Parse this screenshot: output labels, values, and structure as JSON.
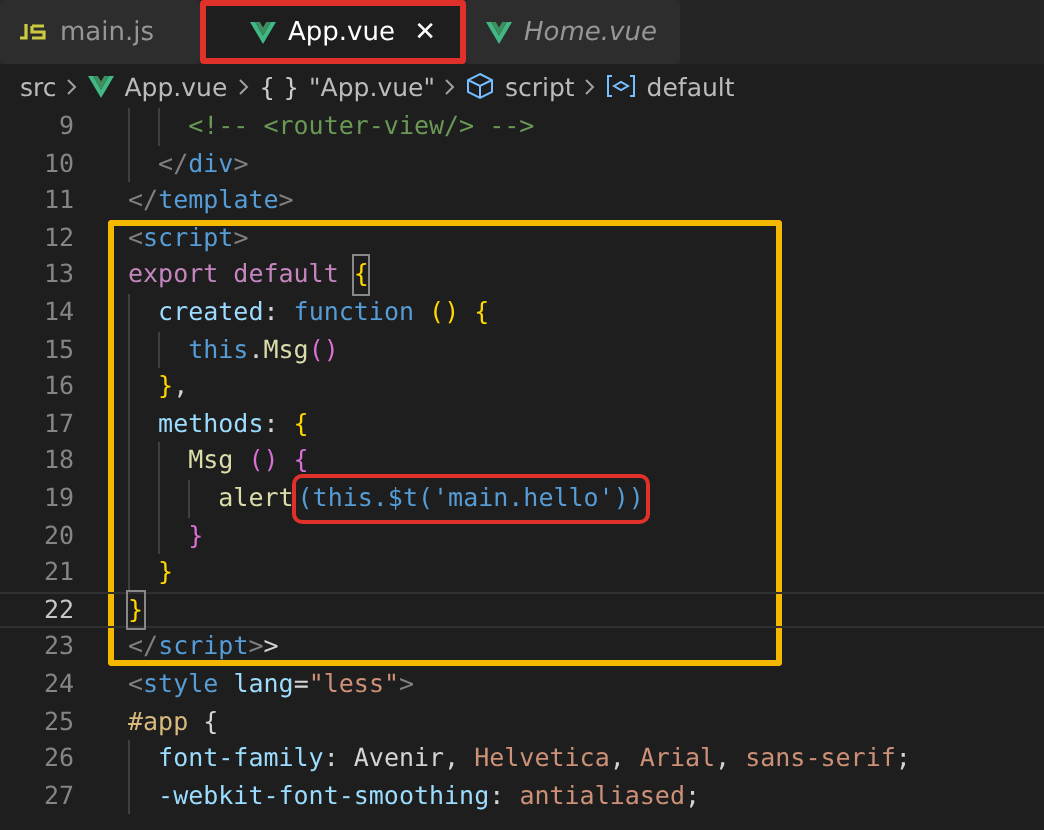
{
  "tabs": [
    {
      "label": "main.js",
      "kind": "script",
      "selected": false,
      "preview": false,
      "boxed": false
    },
    {
      "label": "App.vue",
      "kind": "component",
      "selected": true,
      "preview": false,
      "boxed": true,
      "close": "✕"
    },
    {
      "label": "Home.vue",
      "kind": "component",
      "selected": false,
      "preview": true,
      "boxed": false
    }
  ],
  "breadcrumb": [
    {
      "label": "src",
      "kind": "folder"
    },
    {
      "label": "App.vue",
      "kind": "file"
    },
    {
      "label": "\"App.vue\"",
      "kind": "object",
      "glyph": "{ }"
    },
    {
      "label": "script",
      "kind": "element"
    },
    {
      "label": "default",
      "kind": "symbol"
    }
  ],
  "lines": [
    {
      "number": "9",
      "boxed": false,
      "current": false,
      "tokens": [
        {
          "text": "    <!-- <router-view/> -->",
          "kind": "comment"
        }
      ]
    },
    {
      "number": "10",
      "boxed": false,
      "current": false,
      "tokens": [
        {
          "text": "  </",
          "kind": "tagpunct"
        },
        {
          "text": "div",
          "kind": "tag"
        },
        {
          "text": ">",
          "kind": "tagpunct"
        }
      ]
    },
    {
      "number": "11",
      "boxed": false,
      "current": false,
      "tokens": [
        {
          "text": "</",
          "kind": "tagpunct"
        },
        {
          "text": "template",
          "kind": "tag"
        },
        {
          "text": ">",
          "kind": "tagpunct"
        }
      ]
    },
    {
      "number": "12",
      "boxed": true,
      "current": false,
      "tokens": [
        {
          "text": "<",
          "kind": "tagpunct"
        },
        {
          "text": "script",
          "kind": "tag"
        },
        {
          "text": ">",
          "kind": "tagpunct"
        }
      ]
    },
    {
      "number": "13",
      "boxed": true,
      "current": false,
      "tokens": [
        {
          "text": "export default ",
          "kind": "keyword"
        },
        {
          "text": "{",
          "kind": "match"
        }
      ]
    },
    {
      "number": "14",
      "boxed": true,
      "current": false,
      "tokens": [
        {
          "text": "  created",
          "kind": "property"
        },
        {
          "text": ": ",
          "kind": "plain"
        },
        {
          "text": "function",
          "kind": "storage"
        },
        {
          "text": " () {",
          "kind": "bracket"
        }
      ]
    },
    {
      "number": "15",
      "boxed": true,
      "current": false,
      "tokens": [
        {
          "text": "    this",
          "kind": "storage"
        },
        {
          "text": ".",
          "kind": "plain"
        },
        {
          "text": "Msg",
          "kind": "func"
        },
        {
          "text": "()",
          "kind": "bracket2"
        }
      ]
    },
    {
      "number": "16",
      "boxed": true,
      "current": false,
      "tokens": [
        {
          "text": "  }",
          "kind": "bracket"
        },
        {
          "text": ",",
          "kind": "plain"
        }
      ]
    },
    {
      "number": "17",
      "boxed": true,
      "current": false,
      "tokens": [
        {
          "text": "  methods",
          "kind": "property"
        },
        {
          "text": ": ",
          "kind": "plain"
        },
        {
          "text": "{",
          "kind": "bracket"
        }
      ]
    },
    {
      "number": "18",
      "boxed": true,
      "current": false,
      "tokens": [
        {
          "text": "    Msg",
          "kind": "func"
        },
        {
          "text": " () {",
          "kind": "bracket2"
        }
      ]
    },
    {
      "number": "19",
      "boxed": true,
      "current": false,
      "tokens": [
        {
          "text": "      alert",
          "kind": "func"
        },
        {
          "text": "(this.$t('main.hello'))",
          "kind": "boxed"
        }
      ]
    },
    {
      "number": "20",
      "boxed": true,
      "current": false,
      "tokens": [
        {
          "text": "    }",
          "kind": "bracket2"
        }
      ]
    },
    {
      "number": "21",
      "boxed": true,
      "current": false,
      "tokens": [
        {
          "text": "  }",
          "kind": "bracket"
        }
      ]
    },
    {
      "number": "22",
      "boxed": true,
      "current": true,
      "tokens": [
        {
          "text": "}",
          "kind": "match"
        }
      ]
    },
    {
      "number": "23",
      "boxed": true,
      "current": false,
      "tokens": [
        {
          "text": "</",
          "kind": "tagpunct"
        },
        {
          "text": "script",
          "kind": "tag"
        },
        {
          "text": ">",
          "kind": "tagpunct"
        },
        {
          "text": ">",
          "kind": "plain"
        }
      ]
    },
    {
      "number": "24",
      "boxed": false,
      "current": false,
      "tokens": [
        {
          "text": "<",
          "kind": "tagpunct"
        },
        {
          "text": "style",
          "kind": "tag"
        },
        {
          "text": " lang",
          "kind": "property"
        },
        {
          "text": "=",
          "kind": "plain"
        },
        {
          "text": "\"less\"",
          "kind": "string"
        },
        {
          "text": ">",
          "kind": "tagpunct"
        }
      ]
    },
    {
      "number": "25",
      "boxed": false,
      "current": false,
      "tokens": [
        {
          "text": "#app",
          "kind": "selector"
        },
        {
          "text": " {",
          "kind": "plain"
        }
      ]
    },
    {
      "number": "26",
      "boxed": false,
      "current": false,
      "tokens": [
        {
          "text": "  font-family",
          "kind": "property"
        },
        {
          "text": ": Avenir, ",
          "kind": "plain"
        },
        {
          "text": "Helvetica",
          "kind": "string"
        },
        {
          "text": ", ",
          "kind": "plain"
        },
        {
          "text": "Arial",
          "kind": "string"
        },
        {
          "text": ", ",
          "kind": "plain"
        },
        {
          "text": "sans-serif",
          "kind": "string"
        },
        {
          "text": ";",
          "kind": "plain"
        }
      ]
    },
    {
      "number": "27",
      "boxed": false,
      "current": false,
      "tokens": [
        {
          "text": "  -webkit-font-smoothing",
          "kind": "property"
        },
        {
          "text": ": ",
          "kind": "plain"
        },
        {
          "text": "antialiased",
          "kind": "string"
        },
        {
          "text": ";",
          "kind": "plain"
        }
      ]
    }
  ]
}
